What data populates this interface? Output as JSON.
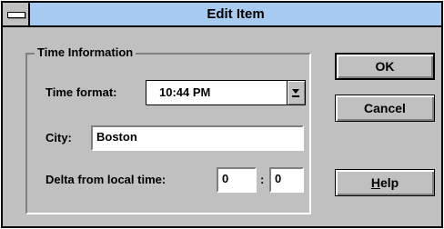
{
  "window": {
    "title": "Edit Item"
  },
  "group": {
    "label": "Time Information",
    "time_format": {
      "label": "Time format:",
      "value": "10:44 PM"
    },
    "city": {
      "label": "City:",
      "value": "Boston"
    },
    "delta": {
      "label": "Delta from local time:",
      "hours": "0",
      "separator": ":",
      "minutes": "0"
    }
  },
  "buttons": {
    "ok": "OK",
    "cancel": "Cancel",
    "help_mnemonic": "H",
    "help_rest": "elp"
  },
  "colors": {
    "titlebar": "#a6caf0",
    "face": "#c0c0c0"
  },
  "icons": {
    "system_menu": "system-menu-icon",
    "dropdown": "dropdown-arrow-icon"
  }
}
